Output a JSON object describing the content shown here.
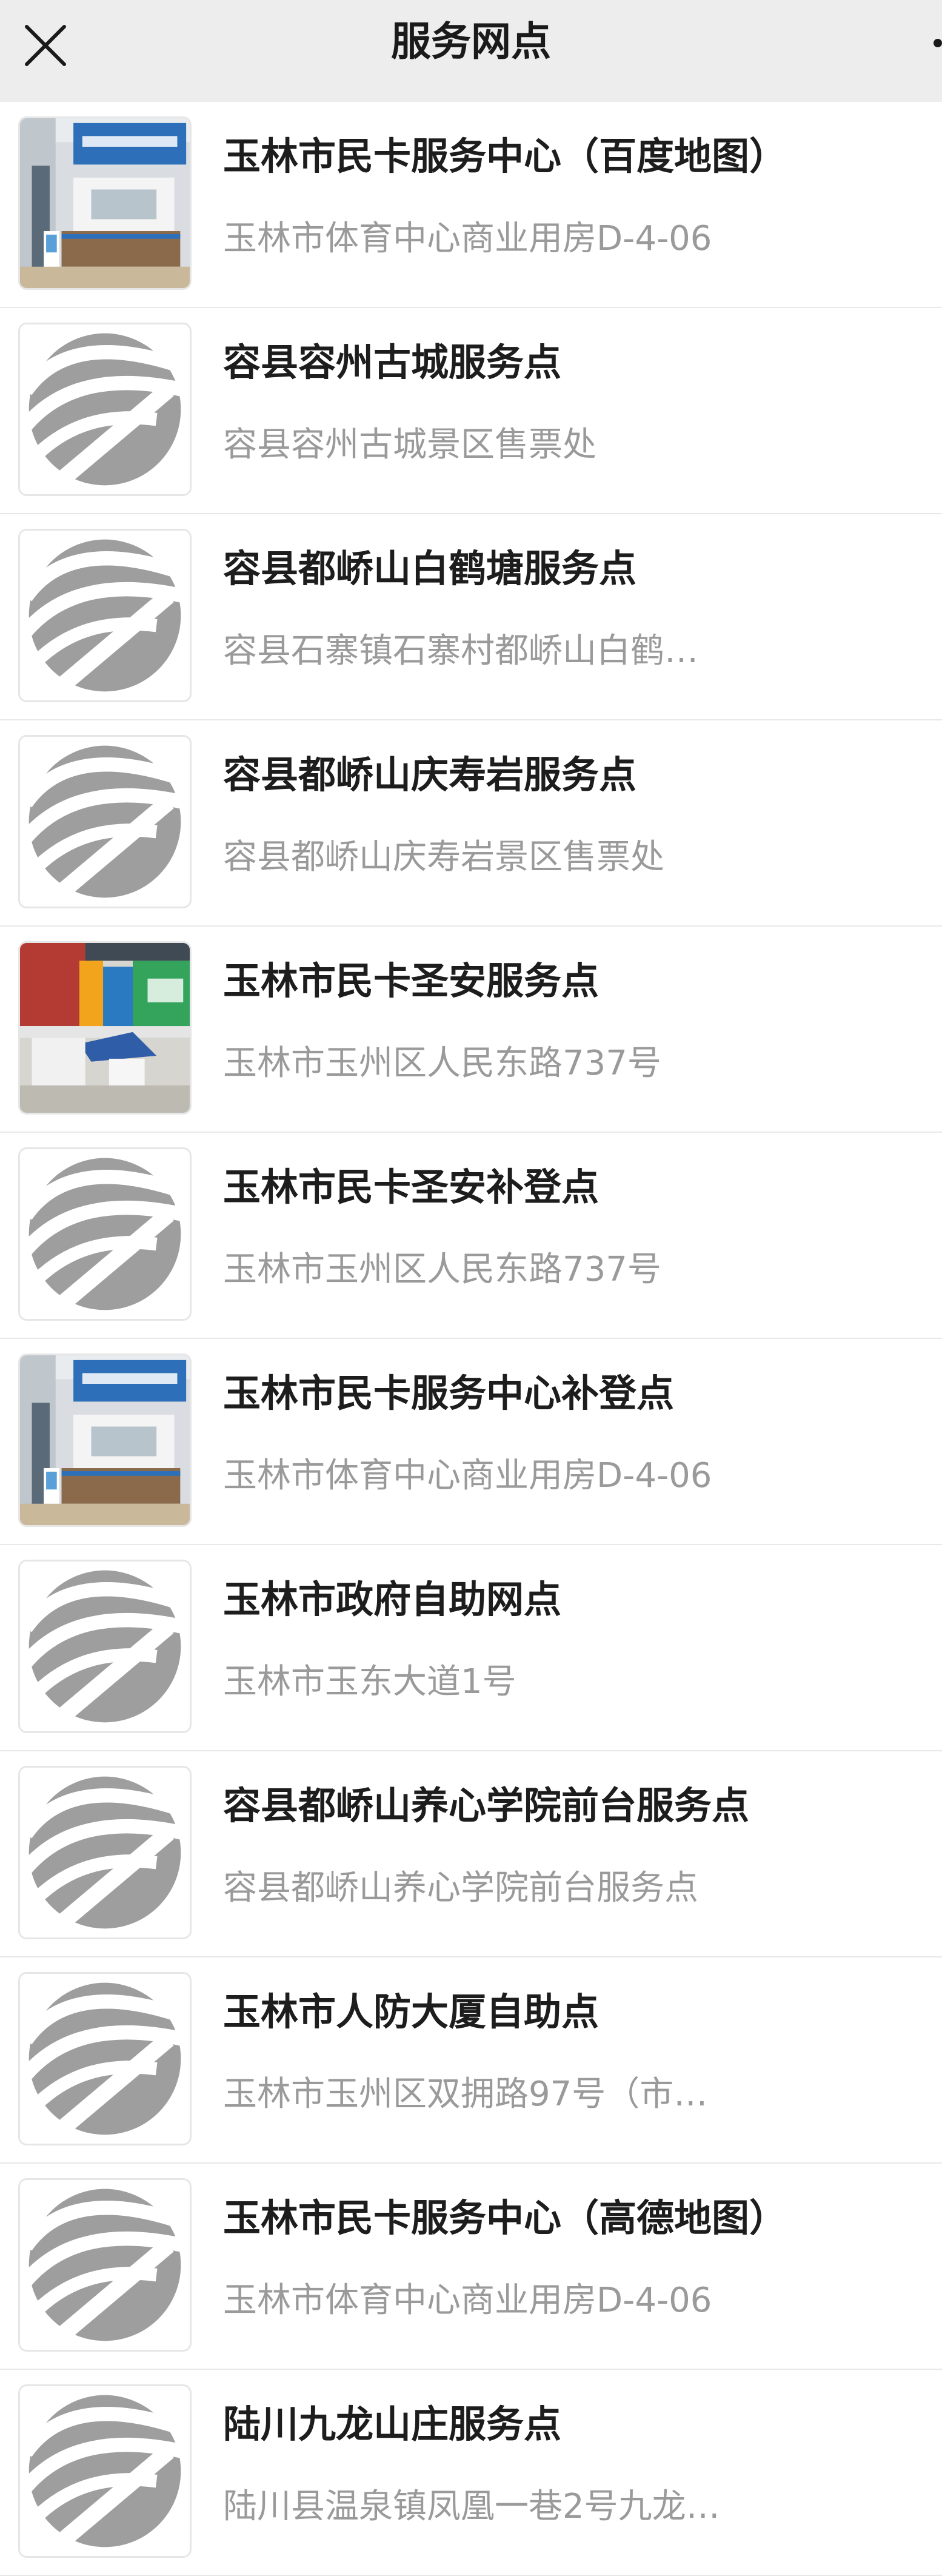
{
  "navbar": {
    "title": "服务网点",
    "close_icon": "close-icon",
    "more_icon": "more-icon"
  },
  "colors": {
    "navbar_bg": "#ededed",
    "title_text": "#1d1d1d",
    "address_text": "#9a9a9a",
    "divider": "#e8e8e8",
    "logo_gray": "#9e9e9e"
  },
  "locations": [
    {
      "name": "玉林市民卡服务中心（百度地图）",
      "address": "玉林市体育中心商业用房D-4-06",
      "thumbnail": "photo-service-center"
    },
    {
      "name": "容县容州古城服务点",
      "address": "容县容州古城景区售票处",
      "thumbnail": "logo-placeholder"
    },
    {
      "name": "容县都峤山白鹤塘服务点",
      "address": "容县石寨镇石寨村都峤山白鹤…",
      "thumbnail": "logo-placeholder"
    },
    {
      "name": "容县都峤山庆寿岩服务点",
      "address": "容县都峤山庆寿岩景区售票处",
      "thumbnail": "logo-placeholder"
    },
    {
      "name": "玉林市民卡圣安服务点",
      "address": "玉林市玉州区人民东路737号",
      "thumbnail": "photo-storefront"
    },
    {
      "name": "玉林市民卡圣安补登点",
      "address": "玉林市玉州区人民东路737号",
      "thumbnail": "logo-placeholder"
    },
    {
      "name": "玉林市民卡服务中心补登点",
      "address": "玉林市体育中心商业用房D-4-06",
      "thumbnail": "photo-service-center"
    },
    {
      "name": "玉林市政府自助网点",
      "address": "玉林市玉东大道1号",
      "thumbnail": "logo-placeholder"
    },
    {
      "name": "容县都峤山养心学院前台服务点",
      "address": "容县都峤山养心学院前台服务点",
      "thumbnail": "logo-placeholder"
    },
    {
      "name": "玉林市人防大厦自助点",
      "address": "玉林市玉州区双拥路97号（市…",
      "thumbnail": "logo-placeholder"
    },
    {
      "name": "玉林市民卡服务中心（高德地图）",
      "address": "玉林市体育中心商业用房D-4-06",
      "thumbnail": "logo-placeholder"
    },
    {
      "name": "陆川九龙山庄服务点",
      "address": "陆川县温泉镇凤凰一巷2号九龙…",
      "thumbnail": "logo-placeholder"
    }
  ]
}
